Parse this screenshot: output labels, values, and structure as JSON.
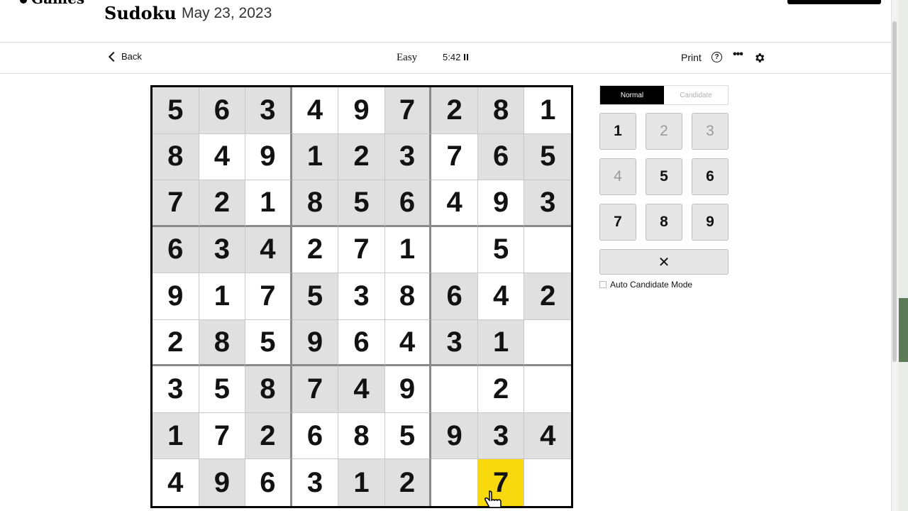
{
  "header": {
    "brand": "Games",
    "title": "Sudoku",
    "date": "May 23, 2023"
  },
  "toolbar": {
    "back_label": "Back",
    "difficulty": "Easy",
    "timer": "5:42",
    "print_label": "Print",
    "help_icon": "?",
    "more_icon": "•••"
  },
  "board": {
    "rows": [
      [
        "5",
        "6",
        "3",
        "4",
        "9",
        "7",
        "2",
        "8",
        "1"
      ],
      [
        "8",
        "4",
        "9",
        "1",
        "2",
        "3",
        "7",
        "6",
        "5"
      ],
      [
        "7",
        "2",
        "1",
        "8",
        "5",
        "6",
        "4",
        "9",
        "3"
      ],
      [
        "6",
        "3",
        "4",
        "2",
        "7",
        "1",
        "",
        "5",
        ""
      ],
      [
        "9",
        "1",
        "7",
        "5",
        "3",
        "8",
        "6",
        "4",
        "2"
      ],
      [
        "2",
        "8",
        "5",
        "9",
        "6",
        "4",
        "3",
        "1",
        ""
      ],
      [
        "3",
        "5",
        "8",
        "7",
        "4",
        "9",
        "",
        "2",
        ""
      ],
      [
        "1",
        "7",
        "2",
        "6",
        "8",
        "5",
        "9",
        "3",
        "4"
      ],
      [
        "4",
        "9",
        "6",
        "3",
        "1",
        "2",
        "",
        "7",
        ""
      ]
    ],
    "shaded": [
      [
        1,
        1,
        1,
        0,
        0,
        1,
        1,
        1,
        0
      ],
      [
        1,
        0,
        0,
        1,
        1,
        1,
        0,
        1,
        1
      ],
      [
        1,
        1,
        0,
        1,
        1,
        1,
        0,
        0,
        1
      ],
      [
        1,
        1,
        1,
        0,
        0,
        0,
        0,
        0,
        0
      ],
      [
        0,
        0,
        0,
        1,
        0,
        0,
        1,
        0,
        1
      ],
      [
        0,
        1,
        0,
        1,
        0,
        0,
        1,
        1,
        0
      ],
      [
        0,
        0,
        1,
        1,
        1,
        0,
        0,
        0,
        0
      ],
      [
        1,
        0,
        1,
        0,
        0,
        0,
        1,
        1,
        1
      ],
      [
        0,
        1,
        0,
        0,
        1,
        1,
        0,
        0,
        0
      ]
    ],
    "selected": [
      8,
      7
    ],
    "selected_color": "#f7d90d"
  },
  "mode_toggle": {
    "normal_label": "Normal",
    "candidate_label": "Candidate",
    "active": "Normal"
  },
  "keypad": {
    "keys": [
      "1",
      "2",
      "3",
      "4",
      "5",
      "6",
      "7",
      "8",
      "9"
    ],
    "dimmed": [
      "2",
      "3",
      "4"
    ],
    "erase_icon": "✕"
  },
  "auto_candidate_label": "Auto Candidate Mode"
}
